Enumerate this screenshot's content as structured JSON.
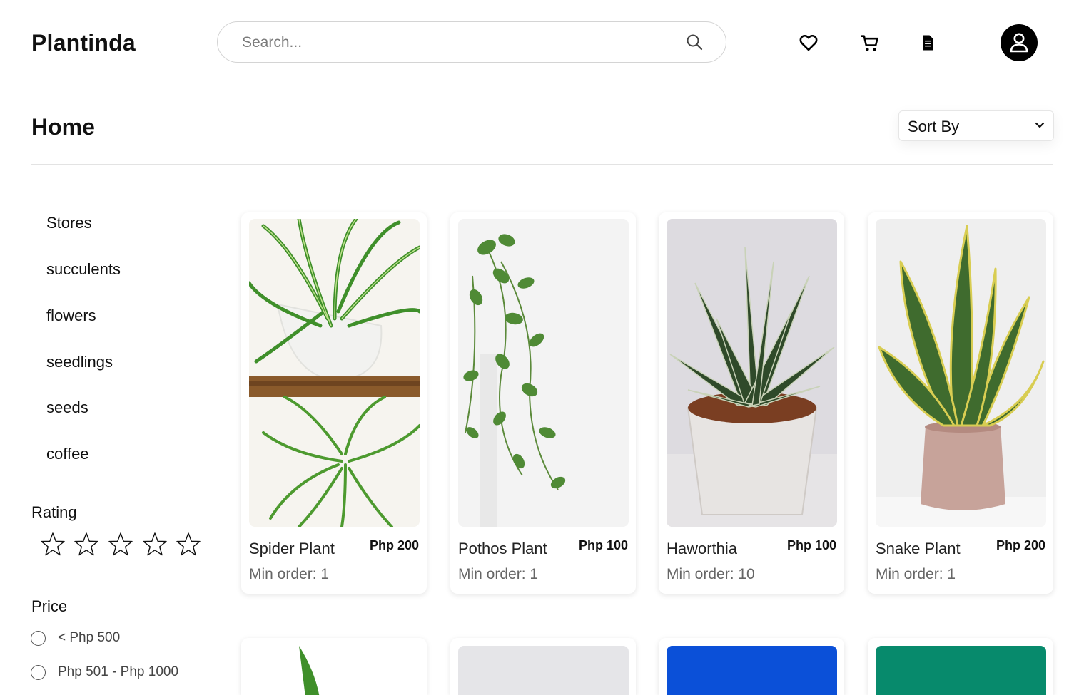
{
  "header": {
    "brand": "Plantinda",
    "search": {
      "placeholder": "Search..."
    },
    "icons": [
      "heart-icon",
      "cart-icon",
      "orders-icon",
      "user-icon"
    ]
  },
  "page": {
    "title": "Home",
    "sort_label": "Sort By"
  },
  "sidebar": {
    "categories": [
      "Stores",
      "succulents",
      "flowers",
      "seedlings",
      "seeds",
      "coffee"
    ],
    "rating_label": "Rating",
    "rating_value": 0,
    "rating_max": 5,
    "price_label": "Price",
    "price_options": [
      "< Php 500",
      "Php 501 - Php 1000"
    ]
  },
  "products": [
    {
      "name": "Spider Plant",
      "price": "Php 200",
      "min_order": "Min order: 1"
    },
    {
      "name": "Pothos Plant",
      "price": "Php 100",
      "min_order": "Min order: 1"
    },
    {
      "name": "Haworthia",
      "price": "Php 100",
      "min_order": "Min order: 10"
    },
    {
      "name": "Snake Plant",
      "price": "Php 200",
      "min_order": "Min order: 1"
    }
  ],
  "colors": {
    "accent": "#000000",
    "card_blue": "#0b50d8",
    "card_green": "#078a6c"
  }
}
